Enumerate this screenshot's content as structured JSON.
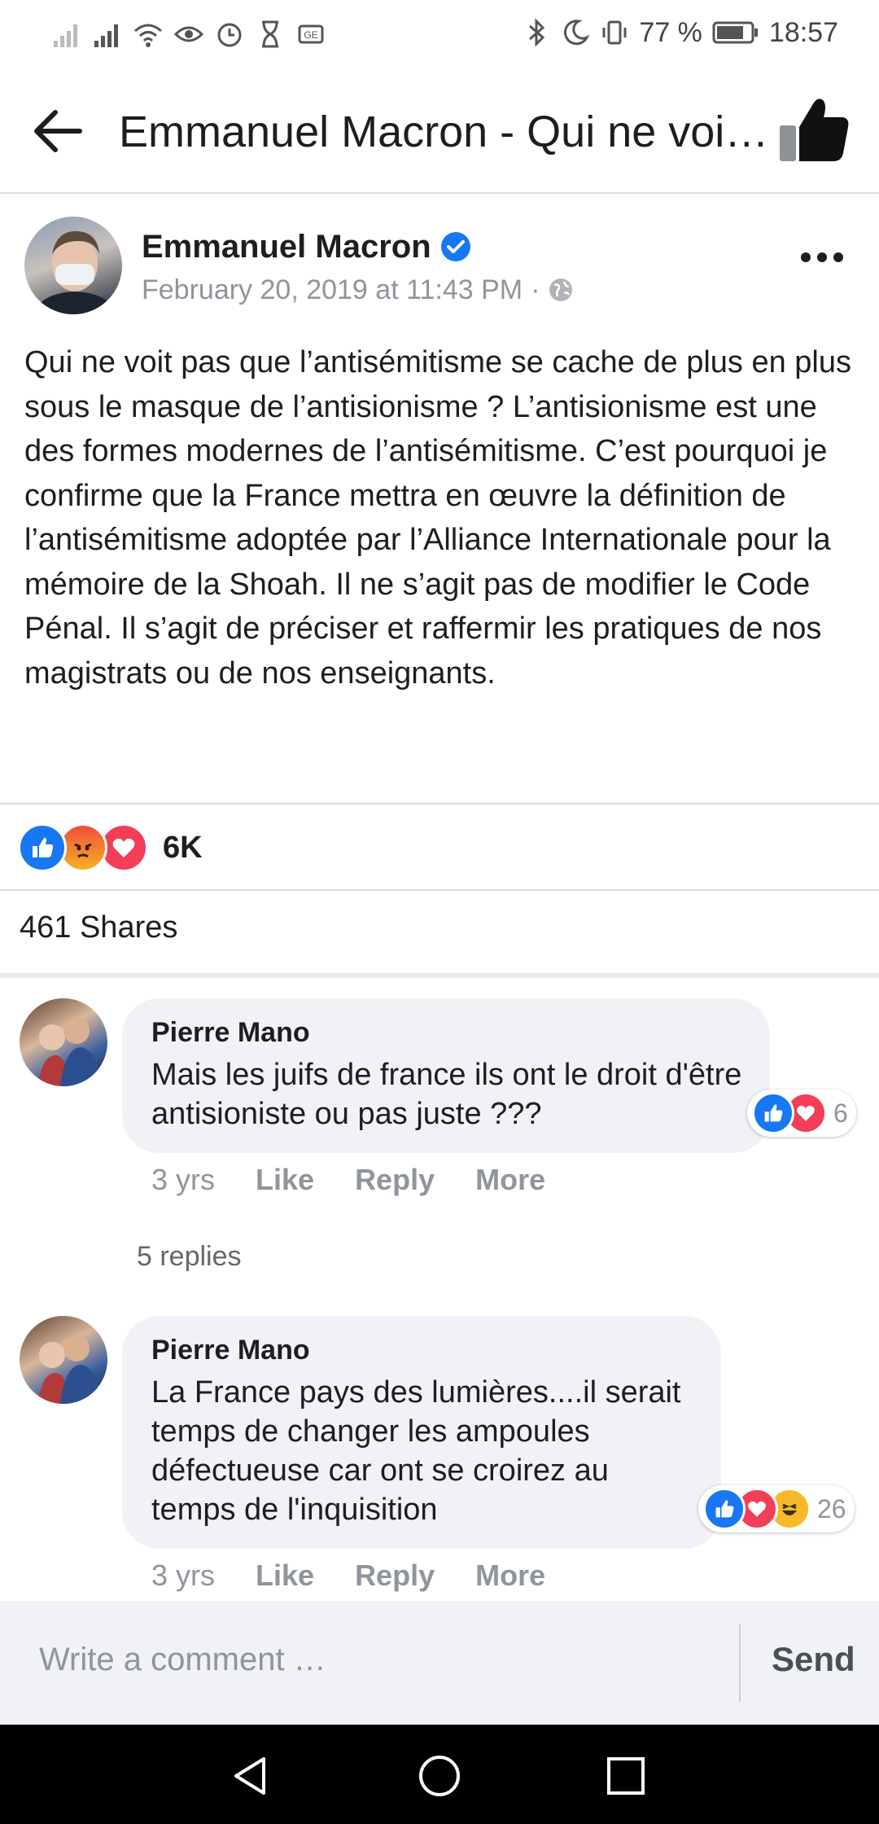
{
  "status_bar": {
    "battery_percent": "77 %",
    "time": "18:57",
    "icons": [
      "signal-icon",
      "signal-icon",
      "wifi-icon",
      "eye-icon",
      "alarm-icon",
      "hourglass-icon",
      "sim-icon",
      "bluetooth-icon",
      "moon-icon",
      "vibrate-icon",
      "battery-icon"
    ]
  },
  "app_bar": {
    "title": "Emmanuel Macron - Qui ne voi…"
  },
  "post": {
    "author": "Emmanuel Macron",
    "date": "February 20, 2019 at 11:43 PM",
    "date_separator": "·",
    "text": "Qui ne voit pas que l’antisémitisme se cache de plus en plus sous le masque de l’antisionisme ? L’antisionisme est une des formes modernes de l’antisémitisme. C’est pourquoi je confirme que la France mettra en œuvre la définition de l’antisémitisme adoptée par l’Alliance Internationale pour la mémoire de la Shoah. Il ne s’agit pas de modifier le Code Pénal. Il s’agit de préciser et raffermir les pratiques de nos magistrats ou de nos enseignants.",
    "reactions_count": "6K",
    "shares": "461 Shares"
  },
  "comments": [
    {
      "name": "Pierre Mano",
      "text": "Mais les juifs de france ils ont le droit d'être antisioniste ou pas juste ???",
      "reaction_count": "6",
      "time": "3 yrs",
      "like": "Like",
      "reply": "Reply",
      "more": "More",
      "replies": "5 replies"
    },
    {
      "name": "Pierre Mano",
      "text": "La France pays des lumières....il serait temps de changer les ampoules défectueuse car ont se croirez au temps de l'inquisition",
      "reaction_count": "26",
      "time": "3 yrs",
      "like": "Like",
      "reply": "Reply",
      "more": "More"
    }
  ],
  "composer": {
    "placeholder": "Write a comment …",
    "send": "Send"
  },
  "colors": {
    "facebook_blue": "#1877f2",
    "love_red": "#f33e58",
    "muted_text": "#90949c"
  }
}
